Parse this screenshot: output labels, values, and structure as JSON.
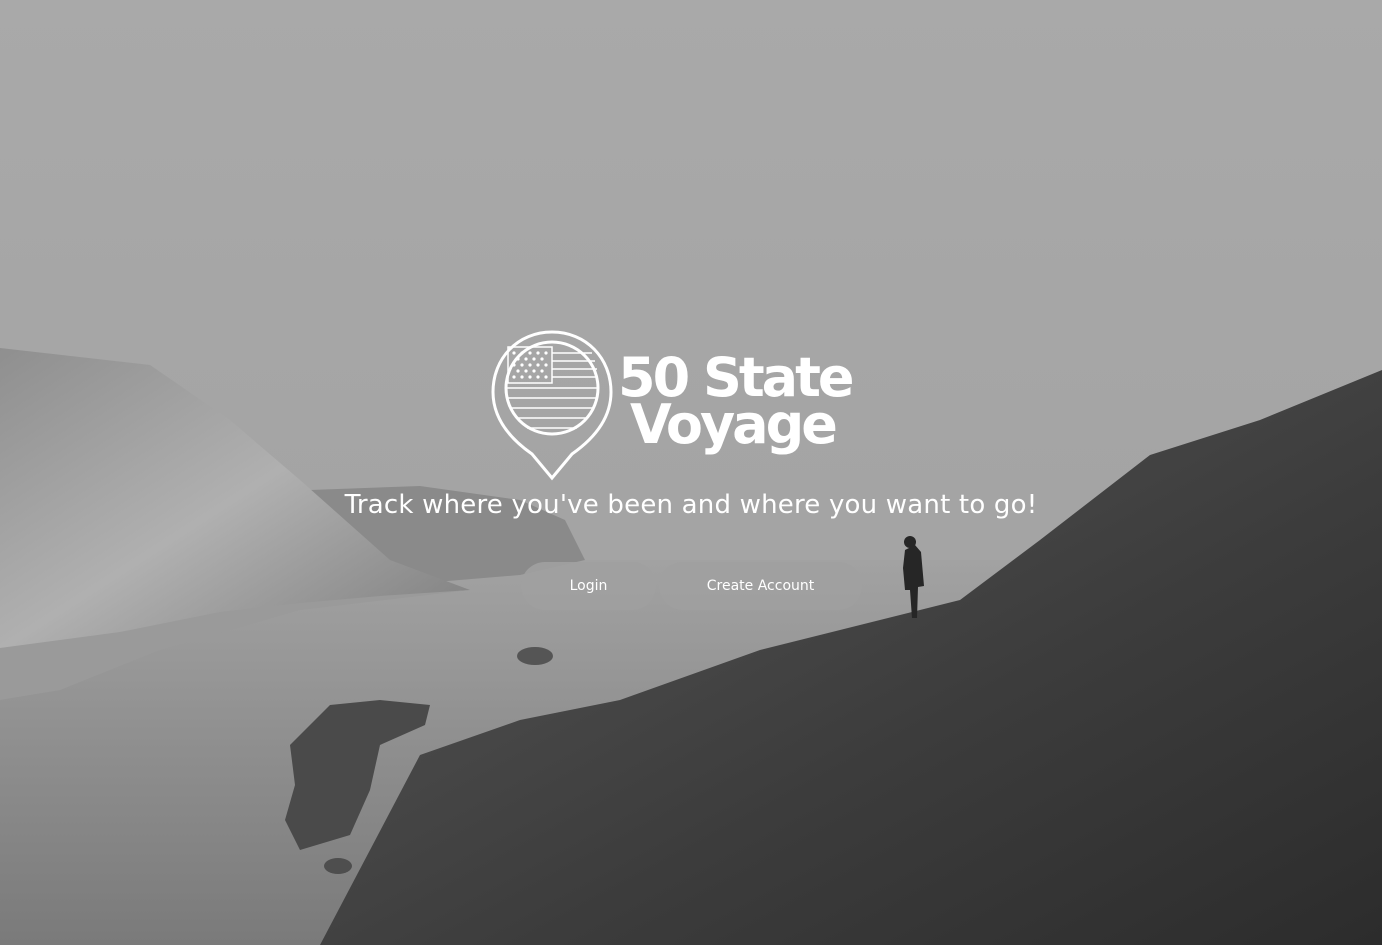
{
  "brand": {
    "line1": "50 State",
    "line2": "Voyage",
    "logo_icon": "map-pin-flag-icon"
  },
  "hero": {
    "tagline": "Track where you've been and where you want to go!",
    "background": "black-and-white photo of a person standing on a coastal cliff overlooking a bay"
  },
  "actions": {
    "login_label": "Login",
    "create_label": "Create Account"
  },
  "colors": {
    "text": "#ffffff",
    "button_bg": "#a0a0a0",
    "sky": "#a6a6a6",
    "cliff_dark": "#333333"
  }
}
